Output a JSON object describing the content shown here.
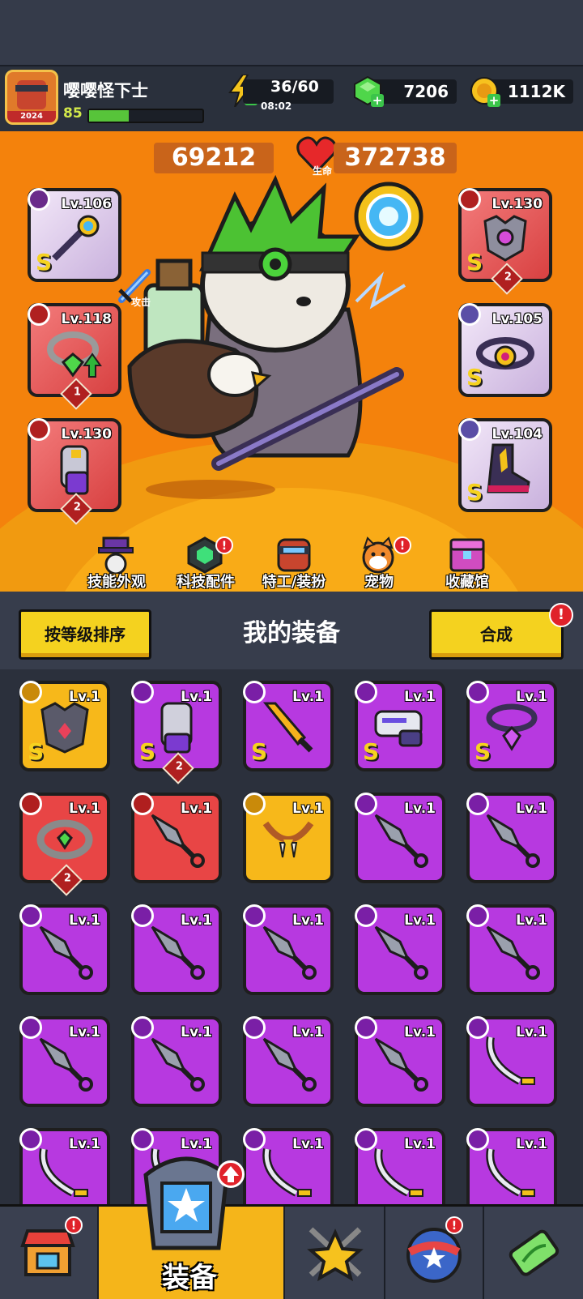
{
  "player": {
    "name": "嘤嘤怪下士",
    "level": "85",
    "avatar_year": "2024",
    "xp_progress": 0.35
  },
  "resources": {
    "energy": "36/60",
    "energy_timer": "08:02",
    "gems": "7206",
    "coins": "1112K"
  },
  "stats": {
    "attack_label": "攻击",
    "attack_value": "69212",
    "hp_label": "生命",
    "hp_value": "372738"
  },
  "equipped": {
    "weapon": {
      "level": "Lv.106",
      "rank": "S"
    },
    "necklace": {
      "level": "Lv.118",
      "stars": "1"
    },
    "gloves": {
      "level": "Lv.130",
      "stars": "2"
    },
    "armor": {
      "level": "Lv.130",
      "rank": "S",
      "stars": "2"
    },
    "belt": {
      "level": "Lv.105",
      "rank": "S"
    },
    "boots": {
      "level": "Lv.104",
      "rank": "S"
    }
  },
  "hero_menu": [
    "技能外观",
    "科技配件",
    "特工/装扮",
    "宠物",
    "收藏馆"
  ],
  "section": {
    "sort_button": "按等级排序",
    "title": "我的装备",
    "merge_button": "合成"
  },
  "inventory_level": "Lv.1",
  "inventory": [
    {
      "rarity": "gold",
      "type": "armor",
      "rank": "S"
    },
    {
      "rarity": "purple",
      "type": "gloves",
      "rank": "S",
      "stars": "2"
    },
    {
      "rarity": "purple",
      "type": "sword",
      "rank": "S"
    },
    {
      "rarity": "purple",
      "type": "gun",
      "rank": "S"
    },
    {
      "rarity": "purple",
      "type": "necklace",
      "rank": "S"
    },
    {
      "rarity": "red",
      "type": "ring",
      "stars": "2"
    },
    {
      "rarity": "red",
      "type": "kunai"
    },
    {
      "rarity": "gold",
      "type": "fang-necklace"
    },
    {
      "rarity": "purple",
      "type": "kunai"
    },
    {
      "rarity": "purple",
      "type": "kunai"
    },
    {
      "rarity": "purple",
      "type": "kunai"
    },
    {
      "rarity": "purple",
      "type": "kunai"
    },
    {
      "rarity": "purple",
      "type": "kunai"
    },
    {
      "rarity": "purple",
      "type": "kunai"
    },
    {
      "rarity": "purple",
      "type": "kunai"
    },
    {
      "rarity": "purple",
      "type": "kunai"
    },
    {
      "rarity": "purple",
      "type": "kunai"
    },
    {
      "rarity": "purple",
      "type": "kunai"
    },
    {
      "rarity": "purple",
      "type": "kunai"
    },
    {
      "rarity": "purple",
      "type": "katana"
    },
    {
      "rarity": "purple",
      "type": "katana"
    },
    {
      "rarity": "purple",
      "type": "katana"
    },
    {
      "rarity": "purple",
      "type": "katana"
    },
    {
      "rarity": "purple",
      "type": "katana"
    },
    {
      "rarity": "purple",
      "type": "katana"
    }
  ],
  "nav": {
    "active_label": "装备"
  },
  "colors": {
    "accent_yellow": "#f4d21f",
    "hero_bg": "#f4820c",
    "epic_purple": "#b739e0",
    "legend_red": "#e84545",
    "mythic_gold": "#f2b81a"
  }
}
